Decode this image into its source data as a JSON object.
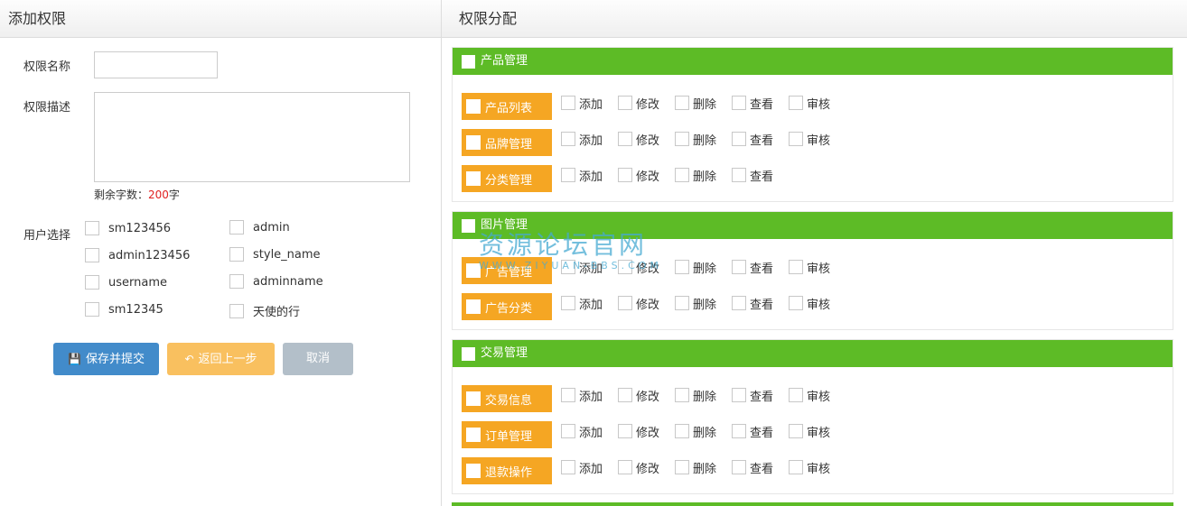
{
  "left": {
    "title": "添加权限",
    "name_label": "权限名称",
    "desc_label": "权限描述",
    "remain_prefix": "剩余字数：",
    "remain_count": "200",
    "remain_suffix": "字",
    "users_label": "用户选择",
    "users": [
      "sm123456",
      "admin",
      "admin123456",
      "style_name",
      "username",
      "adminname",
      "sm12345",
      "天使的行"
    ],
    "buttons": {
      "save": "保存并提交",
      "back": "返回上一步",
      "cancel": "取消"
    }
  },
  "right": {
    "title": "权限分配",
    "sections": [
      {
        "label": "产品管理",
        "items": [
          {
            "label": "产品列表",
            "ops": [
              "添加",
              "修改",
              "删除",
              "查看",
              "审核"
            ]
          },
          {
            "label": "品牌管理",
            "ops": [
              "添加",
              "修改",
              "删除",
              "查看",
              "审核"
            ]
          },
          {
            "label": "分类管理",
            "ops": [
              "添加",
              "修改",
              "删除",
              "查看"
            ]
          }
        ]
      },
      {
        "label": "图片管理",
        "items": [
          {
            "label": "广告管理",
            "ops": [
              "添加",
              "修改",
              "删除",
              "查看",
              "审核"
            ]
          },
          {
            "label": "广告分类",
            "ops": [
              "添加",
              "修改",
              "删除",
              "查看",
              "审核"
            ]
          }
        ]
      },
      {
        "label": "交易管理",
        "items": [
          {
            "label": "交易信息",
            "ops": [
              "添加",
              "修改",
              "删除",
              "查看",
              "审核"
            ]
          },
          {
            "label": "订单管理",
            "ops": [
              "添加",
              "修改",
              "删除",
              "查看",
              "审核"
            ]
          },
          {
            "label": "退款操作",
            "ops": [
              "添加",
              "修改",
              "删除",
              "查看",
              "审核"
            ]
          }
        ]
      }
    ]
  },
  "watermark": {
    "line1": "资源论坛官网",
    "line2": "WWW.ZIYUAN-BBS.COM"
  }
}
